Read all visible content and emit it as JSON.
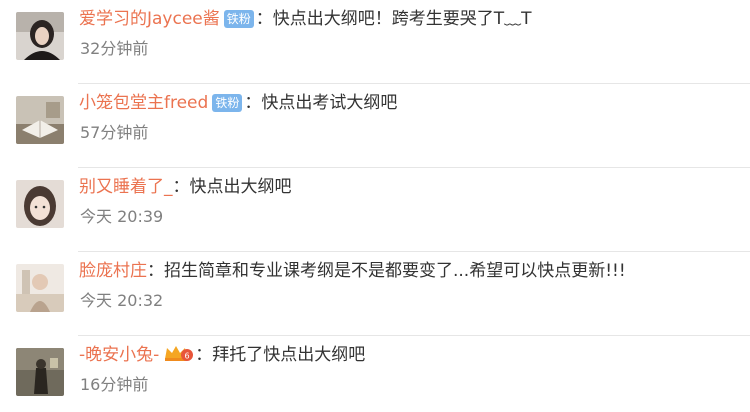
{
  "comments": [
    {
      "username": "爱学习的Jaycee酱",
      "badge": "铁粉",
      "colon": "：",
      "text": "快点出大纲吧！跨考生要哭了T﹏T",
      "time": "32分钟前",
      "avatar": "user-avatar-1"
    },
    {
      "username": "小笼包堂主freed",
      "badge": "铁粉",
      "colon": "：",
      "text": "快点出考试大纲吧",
      "time": "57分钟前",
      "avatar": "user-avatar-2"
    },
    {
      "username": "别又睡着了_",
      "colon": "：",
      "text": "快点出大纲吧",
      "time": "今天 20:39",
      "avatar": "user-avatar-3"
    },
    {
      "username": "脸庞村庄",
      "colon": "：",
      "text": "招生简章和专业课考纲是不是都要变了...希望可以快点更新!!!",
      "time": "今天 20:32",
      "avatar": "user-avatar-4"
    },
    {
      "username": "-晚安小兔-",
      "vip_icon": "vip-crown-icon",
      "colon": "：",
      "text": "拜托了快点出大纲吧",
      "time": "16分钟前",
      "avatar": "user-avatar-5"
    }
  ],
  "colors": {
    "username": "#eb7350",
    "badge_bg": "#7cb5ec",
    "text": "#333333",
    "time": "#808080",
    "divider": "#e6e6e6"
  }
}
